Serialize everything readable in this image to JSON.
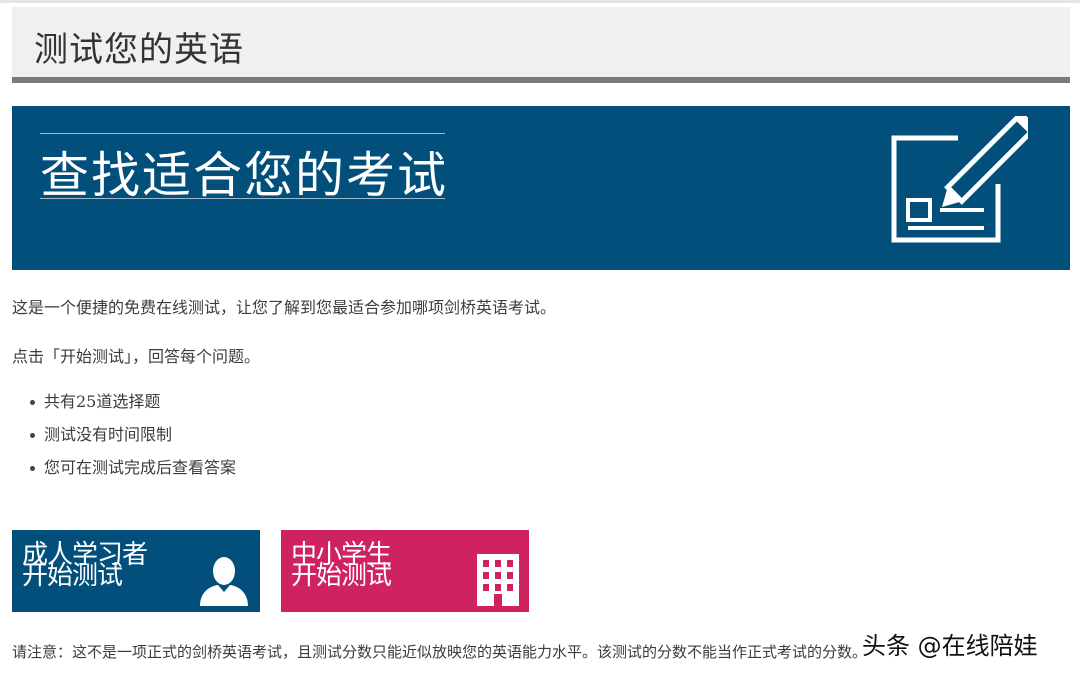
{
  "header": {
    "title": "测试您的英语"
  },
  "banner": {
    "title": "查找适合您的考试",
    "icon": "exam-form-pencil-icon"
  },
  "intro": {
    "line1": "这是一个便捷的免费在线测试，让您了解到您最适合参加哪项剑桥英语考试。",
    "line2": "点击「开始测试」，回答每个问题。"
  },
  "features": [
    {
      "text": "共有25道选择题"
    },
    {
      "text": "测试没有时间限制"
    },
    {
      "text": "您可在测试完成后查看答案"
    }
  ],
  "cta": {
    "adult": {
      "line1": "成人学习者",
      "line2": "开始测试",
      "icon": "person-icon",
      "color": "#034f7b"
    },
    "student": {
      "line1": "中小学生",
      "line2": "开始测试",
      "icon": "school-building-icon",
      "color": "#cf2261"
    }
  },
  "note": "请注意：这不是一项正式的剑桥英语考试，且测试分数只能近似放映您的英语能力水平。该测试的分数不能当作正式考试的分数。",
  "watermark": "头条 @在线陪娃",
  "colors": {
    "brand_blue": "#024f7b",
    "accent_pink": "#cf2261",
    "header_bg": "#f1f0ef",
    "header_bar": "#7b7b7b"
  }
}
